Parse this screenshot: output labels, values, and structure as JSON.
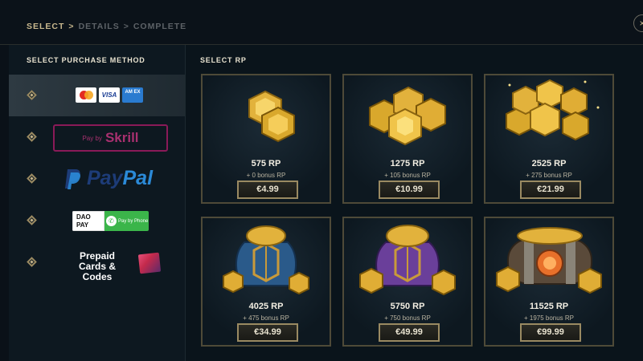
{
  "breadcrumb": {
    "step1": "SELECT",
    "sep1": ">",
    "step2": "DETAILS",
    "sep2": ">",
    "step3": "COMPLETE"
  },
  "close": "×",
  "purchase_method": {
    "title": "SELECT PURCHASE METHOD",
    "cards": {
      "visa": "VISA",
      "amex": "AM EX"
    },
    "skrill": {
      "pay_by": "Pay by",
      "brand": "Skrill"
    },
    "paypal": {
      "part1": "Pay",
      "part2": "Pal"
    },
    "daopay": {
      "dao": "DAO",
      "pay": "PAY",
      "phone_label": "Pay by Phone"
    },
    "prepaid": "Prepaid Cards & Codes"
  },
  "rp": {
    "title": "SELECT RP",
    "packages": [
      {
        "amount": "575 RP",
        "bonus": "+ 0 bonus RP",
        "price": "€4.99"
      },
      {
        "amount": "1275 RP",
        "bonus": "+ 105 bonus RP",
        "price": "€10.99"
      },
      {
        "amount": "2525 RP",
        "bonus": "+ 275 bonus RP",
        "price": "€21.99"
      },
      {
        "amount": "4025 RP",
        "bonus": "+ 475 bonus RP",
        "price": "€34.99"
      },
      {
        "amount": "5750 RP",
        "bonus": "+ 750 bonus RP",
        "price": "€49.99"
      },
      {
        "amount": "11525 RP",
        "bonus": "+ 1975 bonus RP",
        "price": "€99.99"
      }
    ]
  },
  "colors": {
    "gold": "#c9b88e",
    "frame": "#4e4a38",
    "skrill": "#8a1a58"
  }
}
